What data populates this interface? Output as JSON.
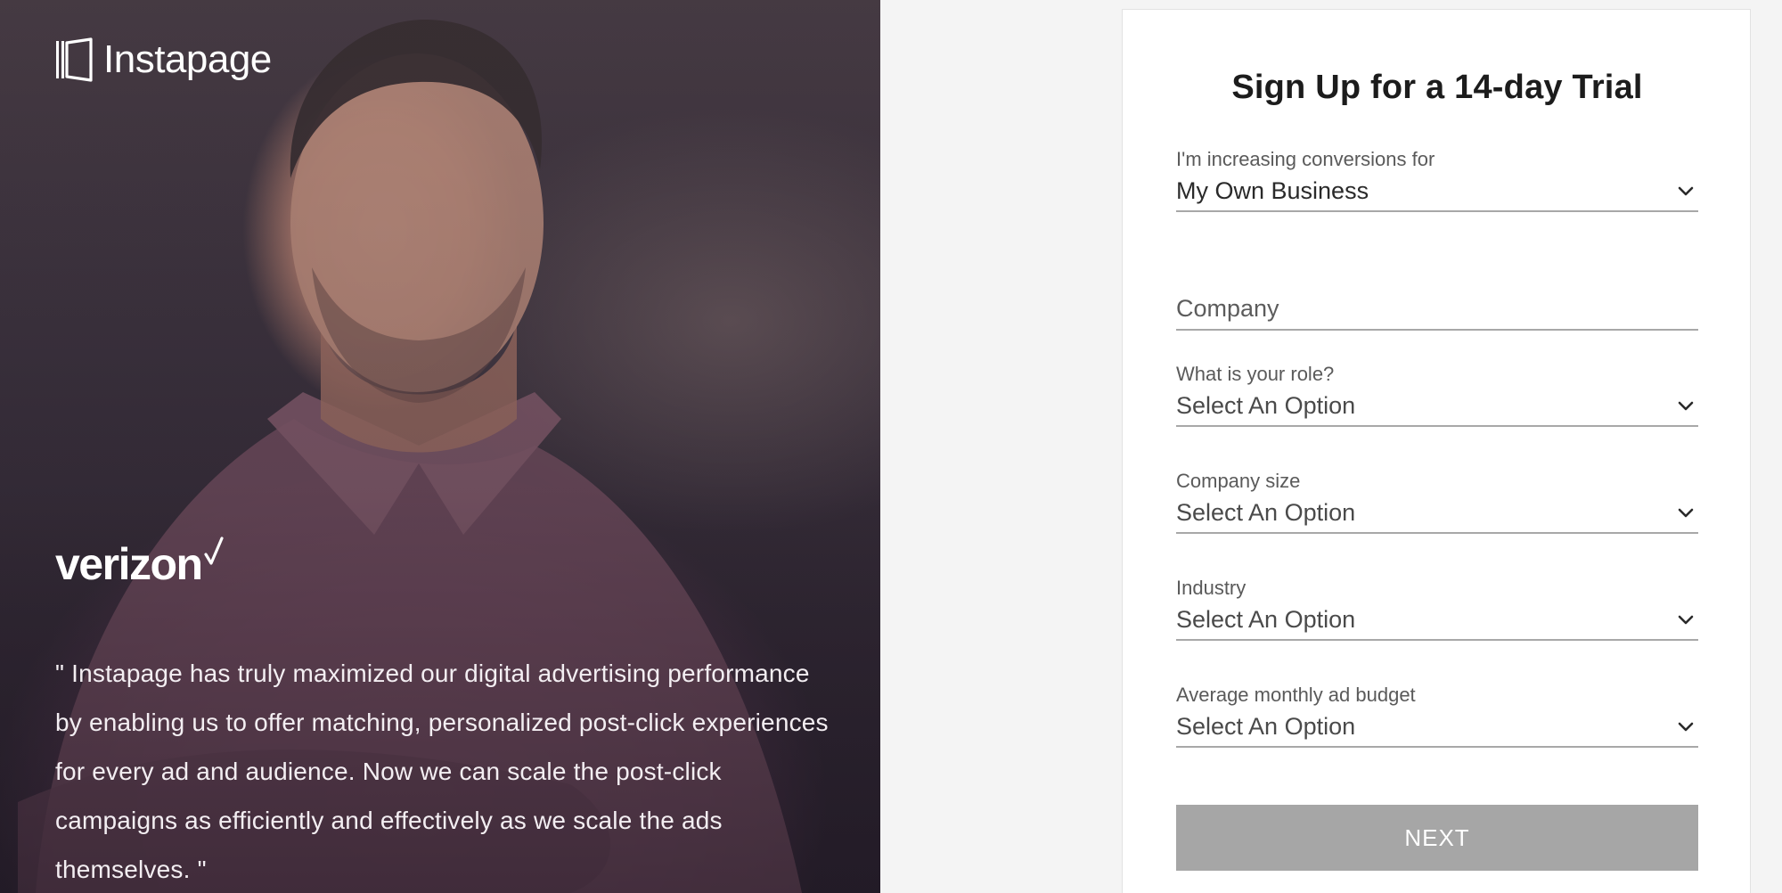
{
  "brand": {
    "name": "Instapage"
  },
  "testimonial": {
    "client_logo": "verizon",
    "quote": "\" Instapage has truly maximized our digital advertising performance by enabling us to offer matching, personalized post-click experiences for every ad and audience. Now we can scale the post-click campaigns as efficiently and effectively as we scale the ads themselves. \""
  },
  "form": {
    "title": "Sign Up for a 14-day Trial",
    "conversions_for": {
      "label": "I'm increasing conversions for",
      "value": "My Own Business"
    },
    "company": {
      "placeholder": "Company",
      "value": ""
    },
    "role": {
      "label": "What is your role?",
      "value": "Select An Option"
    },
    "company_size": {
      "label": "Company size",
      "value": "Select An Option"
    },
    "industry": {
      "label": "Industry",
      "value": "Select An Option"
    },
    "ad_budget": {
      "label": "Average monthly ad budget",
      "value": "Select An Option"
    },
    "next_label": "NEXT"
  },
  "colors": {
    "page_background": "#f4f4f4",
    "card_background": "#ffffff",
    "button_disabled": "#a6a6a6",
    "underline": "#a8a8a8"
  },
  "icons": {
    "brand": "instapage-logo-icon",
    "dropdown": "chevron-down-icon",
    "client_check": "verizon-check-icon"
  }
}
